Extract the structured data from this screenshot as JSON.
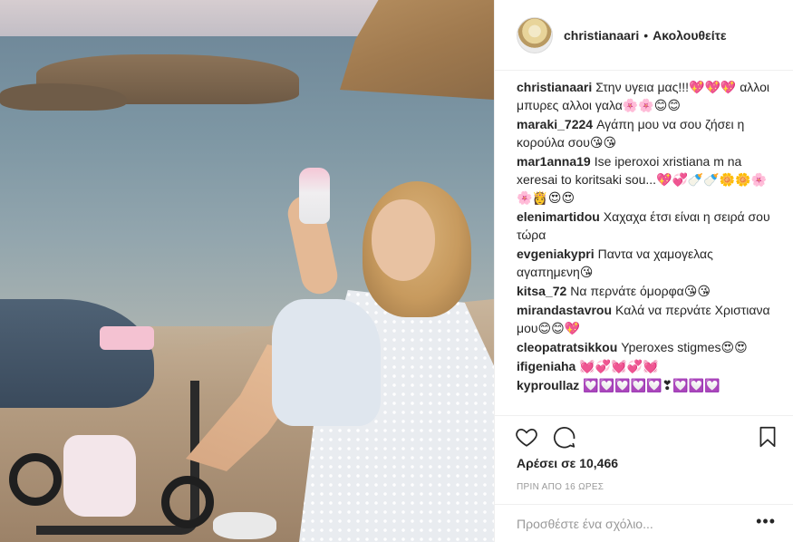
{
  "post": {
    "username": "christianaari",
    "separator": "•",
    "follow_label": "Ακολουθείτε"
  },
  "comments": [
    {
      "user": "christianaari",
      "text": "Στην υγεια μας!!!💖💖💖 αλλοι μπυρες αλλοι γαλα🌸🌸😊😊"
    },
    {
      "user": "maraki_7224",
      "text": "Αγάπη μου να σου ζήσει η κορούλα σου😘😘"
    },
    {
      "user": "mar1anna19",
      "text": "Ise iperoxoi xristiana m na xeresai to koritsaki sou...💖💞🍼🍼🌼🌼🌸🌸👸😍😍"
    },
    {
      "user": "elenimartidou",
      "text": "Χαχαχα έτσι είναι η σειρά σου τώρα"
    },
    {
      "user": "evgeniakypri",
      "text": "Παντα να χαμογελας αγαπημενη😘"
    },
    {
      "user": "kitsa_72",
      "text": "Να περνάτε όμορφα😘😘"
    },
    {
      "user": "mirandastavrou",
      "text": "Καλά να περνάτε Χριστιανα μου😊😊💖"
    },
    {
      "user": "cleopatratsikkou",
      "text": "Yperoxes stigmes😍😍"
    },
    {
      "user": "ifigeniaha",
      "text": "💓💞💓💞💓"
    },
    {
      "user": "kyproullaz",
      "text": "💟💟💟💟💟❣💟💟💟"
    }
  ],
  "actions": {
    "likes_text": "Αρέσει σε 10,466",
    "time_text": "ΠΡΙΝ ΑΠΟ 16 ΩΡΕΣ",
    "comment_placeholder": "Προσθέστε ένα σχόλιο...",
    "more_symbol": "•••"
  },
  "icons": {
    "like": "heart-icon",
    "comment": "speech-bubble-icon",
    "save": "bookmark-icon",
    "more": "more-options-icon"
  },
  "colors": {
    "text": "#262626",
    "muted": "#999999",
    "border": "#efefef"
  }
}
